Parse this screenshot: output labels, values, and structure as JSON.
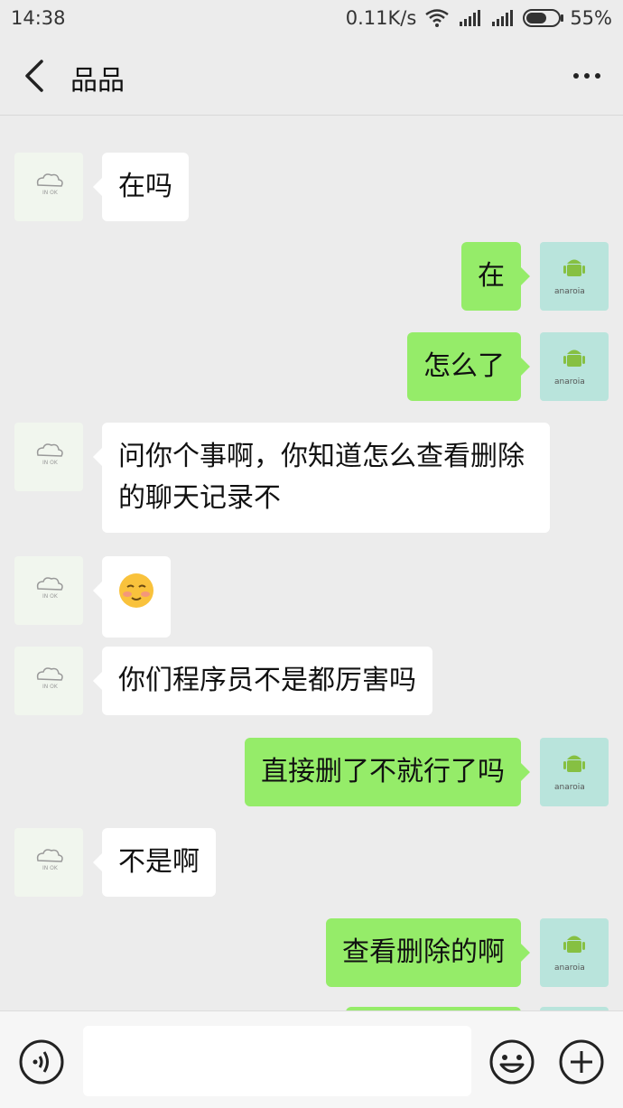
{
  "status_bar": {
    "time": "14:38",
    "net_speed": "0.11K/s",
    "battery": "55%"
  },
  "header": {
    "title": "品品"
  },
  "messages": [
    {
      "side": "left",
      "text": "在吗"
    },
    {
      "side": "right",
      "text": "在"
    },
    {
      "side": "right",
      "text": "怎么了"
    },
    {
      "side": "left",
      "text": "问你个事啊，你知道怎么查看删除的聊天记录不"
    },
    {
      "side": "left",
      "text": "",
      "emoji": "smiling-blush-emoji"
    },
    {
      "side": "left",
      "text": "你们程序员不是都厉害吗"
    },
    {
      "side": "right",
      "text": "直接删了不就行了吗"
    },
    {
      "side": "left",
      "text": "不是啊"
    },
    {
      "side": "right",
      "text": "查看删除的啊"
    }
  ],
  "input": {
    "value": "",
    "placeholder": ""
  },
  "colors": {
    "background": "#ececec",
    "own_bubble": "#95ec69",
    "other_bubble": "#ffffff"
  }
}
